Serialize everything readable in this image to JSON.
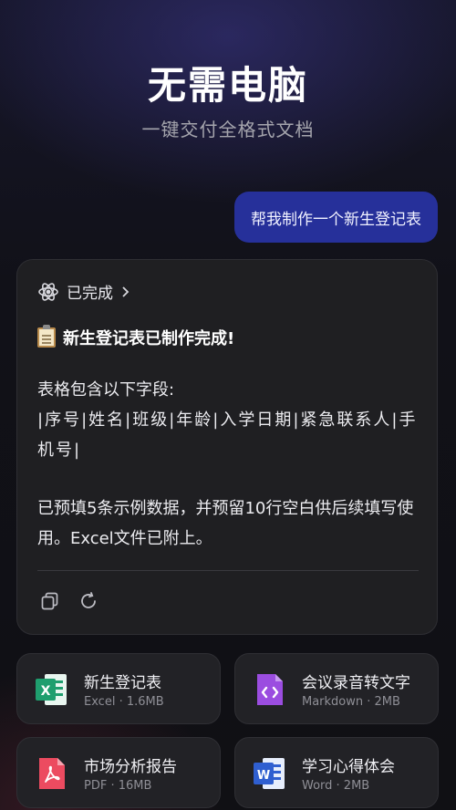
{
  "header": {
    "headline": "无需电脑",
    "subline": "一键交付全格式文档"
  },
  "user_message": "帮我制作一个新生登记表",
  "reply": {
    "status": "已完成",
    "title": "新生登记表已制作完成!",
    "fields_intro": "表格包含以下字段:",
    "fields": "|序号|姓名|班级|年龄|入学日期|紧急联系人|手机号|",
    "note": "已预填5条示例数据，并预留10行空白供后续填写使用。Excel文件已附上。"
  },
  "files": [
    {
      "name": "新生登记表",
      "meta": "Excel · 1.6MB",
      "icon": "excel-icon",
      "color": "#1f9e6e"
    },
    {
      "name": "会议录音转文字",
      "meta": "Markdown · 2MB",
      "icon": "markdown-icon",
      "color": "#9b4de0"
    },
    {
      "name": "市场分析报告",
      "meta": "PDF · 16MB",
      "icon": "pdf-icon",
      "color": "#ec4b60"
    },
    {
      "name": "学习心得体会",
      "meta": "Word · 2MB",
      "icon": "word-icon",
      "color": "#2f5fd0"
    }
  ],
  "colors": {
    "user_bubble": "#26309a",
    "card_bg": "#1f1f22"
  }
}
